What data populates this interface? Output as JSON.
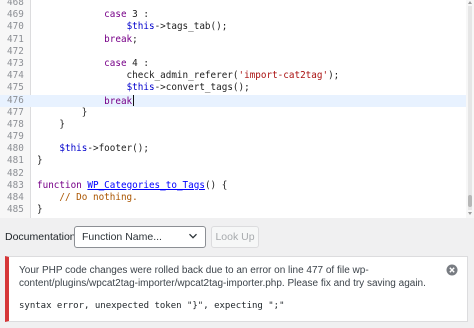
{
  "editor": {
    "lines": [
      {
        "n": "468",
        "segs": [
          {
            "c": "",
            "t": ""
          }
        ]
      },
      {
        "n": "469",
        "segs": [
          {
            "c": "",
            "t": "            "
          },
          {
            "c": "kw",
            "t": "case"
          },
          {
            "c": "",
            "t": " 3 :"
          }
        ]
      },
      {
        "n": "470",
        "segs": [
          {
            "c": "",
            "t": "                "
          },
          {
            "c": "var",
            "t": "$this"
          },
          {
            "c": "",
            "t": "->tags_tab();"
          }
        ]
      },
      {
        "n": "471",
        "segs": [
          {
            "c": "",
            "t": "            "
          },
          {
            "c": "kw",
            "t": "break"
          },
          {
            "c": "",
            "t": ";"
          }
        ]
      },
      {
        "n": "472",
        "segs": [
          {
            "c": "",
            "t": ""
          }
        ]
      },
      {
        "n": "473",
        "segs": [
          {
            "c": "",
            "t": "            "
          },
          {
            "c": "kw",
            "t": "case"
          },
          {
            "c": "",
            "t": " 4 :"
          }
        ]
      },
      {
        "n": "474",
        "segs": [
          {
            "c": "",
            "t": "                check_admin_referer("
          },
          {
            "c": "str",
            "t": "'import-cat2tag'"
          },
          {
            "c": "",
            "t": ");"
          }
        ]
      },
      {
        "n": "475",
        "segs": [
          {
            "c": "",
            "t": "                "
          },
          {
            "c": "var",
            "t": "$this"
          },
          {
            "c": "",
            "t": "->convert_tags();"
          }
        ]
      },
      {
        "n": "476",
        "segs": [
          {
            "c": "",
            "t": "            "
          },
          {
            "c": "kw",
            "t": "break"
          }
        ],
        "active": true,
        "cursor": true
      },
      {
        "n": "477",
        "segs": [
          {
            "c": "",
            "t": "        }"
          }
        ]
      },
      {
        "n": "478",
        "segs": [
          {
            "c": "",
            "t": "    }"
          }
        ]
      },
      {
        "n": "479",
        "segs": [
          {
            "c": "",
            "t": ""
          }
        ]
      },
      {
        "n": "480",
        "segs": [
          {
            "c": "",
            "t": "    "
          },
          {
            "c": "var",
            "t": "$this"
          },
          {
            "c": "",
            "t": "->footer();"
          }
        ]
      },
      {
        "n": "481",
        "segs": [
          {
            "c": "",
            "t": "}"
          }
        ]
      },
      {
        "n": "482",
        "segs": [
          {
            "c": "",
            "t": ""
          }
        ]
      },
      {
        "n": "483",
        "segs": [
          {
            "c": "kw",
            "t": "function"
          },
          {
            "c": "",
            "t": " "
          },
          {
            "c": "fn-def",
            "t": "WP_Categories_to_Tags"
          },
          {
            "c": "",
            "t": "() {"
          }
        ]
      },
      {
        "n": "484",
        "segs": [
          {
            "c": "",
            "t": "    "
          },
          {
            "c": "cm",
            "t": "// Do nothing."
          }
        ]
      },
      {
        "n": "485",
        "segs": [
          {
            "c": "",
            "t": "}"
          }
        ]
      }
    ]
  },
  "docbar": {
    "label": "Documentation:",
    "select_value": "Function Name...",
    "lookup_label": "Look Up"
  },
  "notice": {
    "message": "Your PHP code changes were rolled back due to an error on line 477 of file wp-content/plugins/wpcat2tag-importer/wpcat2tag-importer.php. Please fix and try saving again.",
    "detail": "syntax error, unexpected token \"}\", expecting \";\""
  },
  "colors": {
    "error_accent": "#d63638",
    "active_line": "#e8f2ff",
    "keyword": "#770088",
    "variable": "#0000cc",
    "string": "#aa1111",
    "comment": "#aa5500"
  },
  "icons": [
    "chevron-down-icon",
    "dismiss-icon"
  ]
}
